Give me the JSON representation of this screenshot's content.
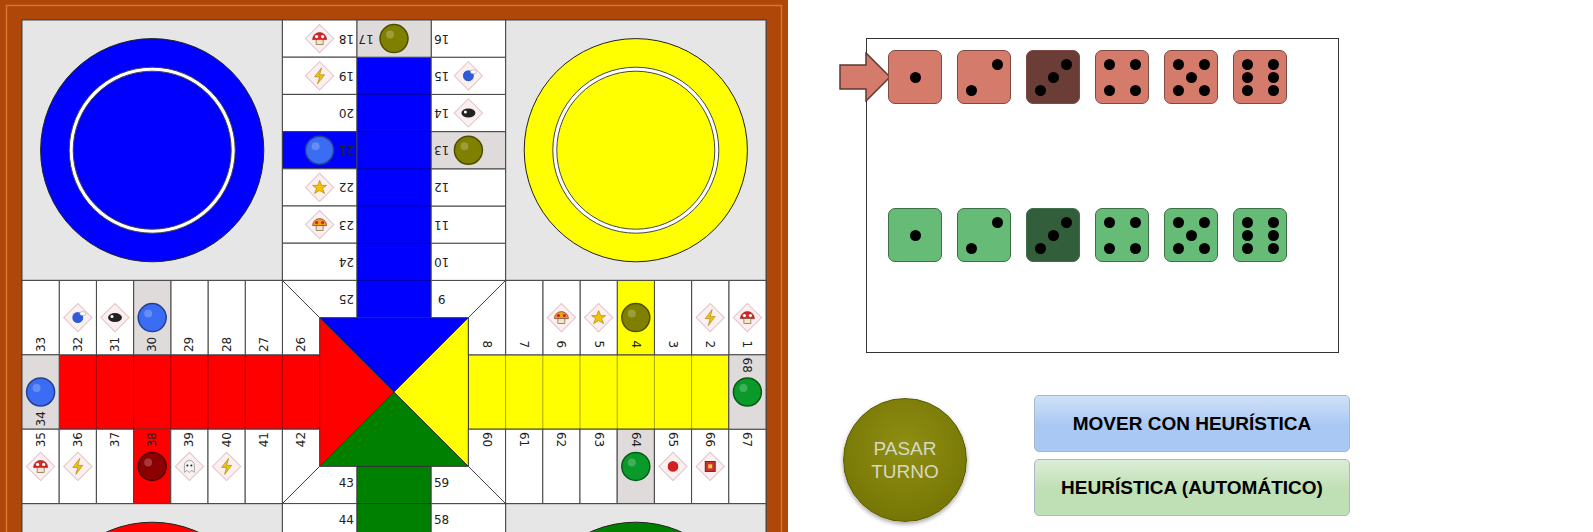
{
  "board": {
    "homes": [
      {
        "color": "#0000ff"
      },
      {
        "color": "#ffff00"
      },
      {
        "color": "#ff0000"
      },
      {
        "color": "#008000"
      }
    ],
    "lanes": [
      {
        "color": "#0000ff"
      },
      {
        "color": "#ffff00"
      },
      {
        "color": "#008000"
      },
      {
        "color": "#ff0000"
      }
    ],
    "squares": [
      {
        "number": "1",
        "kind": "plain",
        "item": "mushroom",
        "piece": null
      },
      {
        "number": "2",
        "kind": "plain",
        "item": "lightning",
        "piece": null
      },
      {
        "number": "3",
        "kind": "plain",
        "item": null,
        "piece": null
      },
      {
        "number": "4",
        "kind": "start",
        "color": "#ffff00",
        "item": null,
        "piece": "#808000"
      },
      {
        "number": "5",
        "kind": "plain",
        "item": "star",
        "piece": null
      },
      {
        "number": "6",
        "kind": "plain",
        "item": "mega-mushroom",
        "piece": null
      },
      {
        "number": "7",
        "kind": "plain",
        "item": null,
        "piece": null
      },
      {
        "number": "8",
        "kind": "plain",
        "item": null,
        "piece": null
      },
      {
        "number": "9",
        "kind": "plain",
        "item": null,
        "piece": null
      },
      {
        "number": "10",
        "kind": "plain",
        "item": null,
        "piece": null
      },
      {
        "number": "11",
        "kind": "plain",
        "item": null,
        "piece": null
      },
      {
        "number": "12",
        "kind": "plain",
        "item": null,
        "piece": null
      },
      {
        "number": "13",
        "kind": "safe",
        "item": null,
        "piece": "#808000"
      },
      {
        "number": "14",
        "kind": "plain",
        "item": "bullet",
        "piece": null
      },
      {
        "number": "15",
        "kind": "plain",
        "item": "blue-shell",
        "piece": null
      },
      {
        "number": "16",
        "kind": "plain",
        "item": null,
        "piece": null
      },
      {
        "number": "17",
        "kind": "safe",
        "item": null,
        "piece": "#808000"
      },
      {
        "number": "18",
        "kind": "plain",
        "item": "mushroom",
        "piece": null
      },
      {
        "number": "19",
        "kind": "plain",
        "item": "lightning",
        "piece": null
      },
      {
        "number": "20",
        "kind": "plain",
        "item": null,
        "piece": null
      },
      {
        "number": "21",
        "kind": "start",
        "color": "#0000ff",
        "item": null,
        "piece": "#3b6cf4"
      },
      {
        "number": "22",
        "kind": "plain",
        "item": "star",
        "piece": null
      },
      {
        "number": "23",
        "kind": "plain",
        "item": "mega-mushroom",
        "piece": null
      },
      {
        "number": "24",
        "kind": "plain",
        "item": null,
        "piece": null
      },
      {
        "number": "25",
        "kind": "plain",
        "item": null,
        "piece": null
      },
      {
        "number": "26",
        "kind": "plain",
        "item": null,
        "piece": null
      },
      {
        "number": "27",
        "kind": "plain",
        "item": null,
        "piece": null
      },
      {
        "number": "28",
        "kind": "plain",
        "item": null,
        "piece": null
      },
      {
        "number": "29",
        "kind": "plain",
        "item": null,
        "piece": null
      },
      {
        "number": "30",
        "kind": "safe",
        "item": null,
        "piece": "#3b6cf4"
      },
      {
        "number": "31",
        "kind": "plain",
        "item": "bullet",
        "piece": null
      },
      {
        "number": "32",
        "kind": "plain",
        "item": "blue-shell",
        "piece": null
      },
      {
        "number": "33",
        "kind": "plain",
        "item": null,
        "piece": null
      },
      {
        "number": "34",
        "kind": "safe",
        "item": null,
        "piece": "#3b6cf4"
      },
      {
        "number": "35",
        "kind": "plain",
        "item": "mushroom",
        "piece": null
      },
      {
        "number": "36",
        "kind": "plain",
        "item": "lightning",
        "piece": null
      },
      {
        "number": "37",
        "kind": "plain",
        "item": null,
        "piece": null
      },
      {
        "number": "38",
        "kind": "start",
        "color": "#ff0000",
        "item": null,
        "piece": "#8b0000"
      },
      {
        "number": "39",
        "kind": "plain",
        "item": "ghost",
        "piece": null
      },
      {
        "number": "40",
        "kind": "plain",
        "item": "lightning",
        "piece": null
      },
      {
        "number": "41",
        "kind": "plain",
        "item": null,
        "piece": null
      },
      {
        "number": "42",
        "kind": "plain",
        "item": null,
        "piece": null
      },
      {
        "number": "43",
        "kind": "plain",
        "item": null,
        "piece": null
      },
      {
        "number": "44",
        "kind": "plain",
        "item": null,
        "piece": null
      },
      {
        "number": "58",
        "kind": "plain",
        "item": null,
        "piece": null
      },
      {
        "number": "59",
        "kind": "plain",
        "item": null,
        "piece": null
      },
      {
        "number": "60",
        "kind": "plain",
        "item": null,
        "piece": null
      },
      {
        "number": "61",
        "kind": "plain",
        "item": null,
        "piece": null
      },
      {
        "number": "62",
        "kind": "plain",
        "item": null,
        "piece": null
      },
      {
        "number": "63",
        "kind": "plain",
        "item": null,
        "piece": null
      },
      {
        "number": "64",
        "kind": "safe",
        "item": null,
        "piece": "#0a9a2a"
      },
      {
        "number": "65",
        "kind": "plain",
        "item": "red-shell",
        "piece": null
      },
      {
        "number": "66",
        "kind": "plain",
        "item": "item-box",
        "piece": null
      },
      {
        "number": "67",
        "kind": "plain",
        "item": null,
        "piece": null
      },
      {
        "number": "68",
        "kind": "safe",
        "item": null,
        "piece": "#0a9a2a"
      }
    ]
  },
  "dice_rows": [
    {
      "color": "#d47b6c",
      "selected": true,
      "dice": [
        {
          "value": 1,
          "used": false
        },
        {
          "value": 2,
          "used": false
        },
        {
          "value": 3,
          "used": true
        },
        {
          "value": 4,
          "used": false
        },
        {
          "value": 5,
          "used": false
        },
        {
          "value": 6,
          "used": false
        }
      ]
    },
    {
      "color": "#66bb77",
      "selected": false,
      "dice": [
        {
          "value": 1,
          "used": false
        },
        {
          "value": 2,
          "used": false
        },
        {
          "value": 3,
          "used": true
        },
        {
          "value": 4,
          "used": false
        },
        {
          "value": 5,
          "used": false
        },
        {
          "value": 6,
          "used": false
        }
      ]
    }
  ],
  "pass_button": {
    "label": "PASAR TURNO"
  },
  "actions": [
    {
      "label": "MOVER CON HEURÍSTICA",
      "color": "#a9c8f3"
    },
    {
      "label": "HEURÍSTICA (AUTOMÁTICO)",
      "color": "#bfdfb4"
    }
  ]
}
